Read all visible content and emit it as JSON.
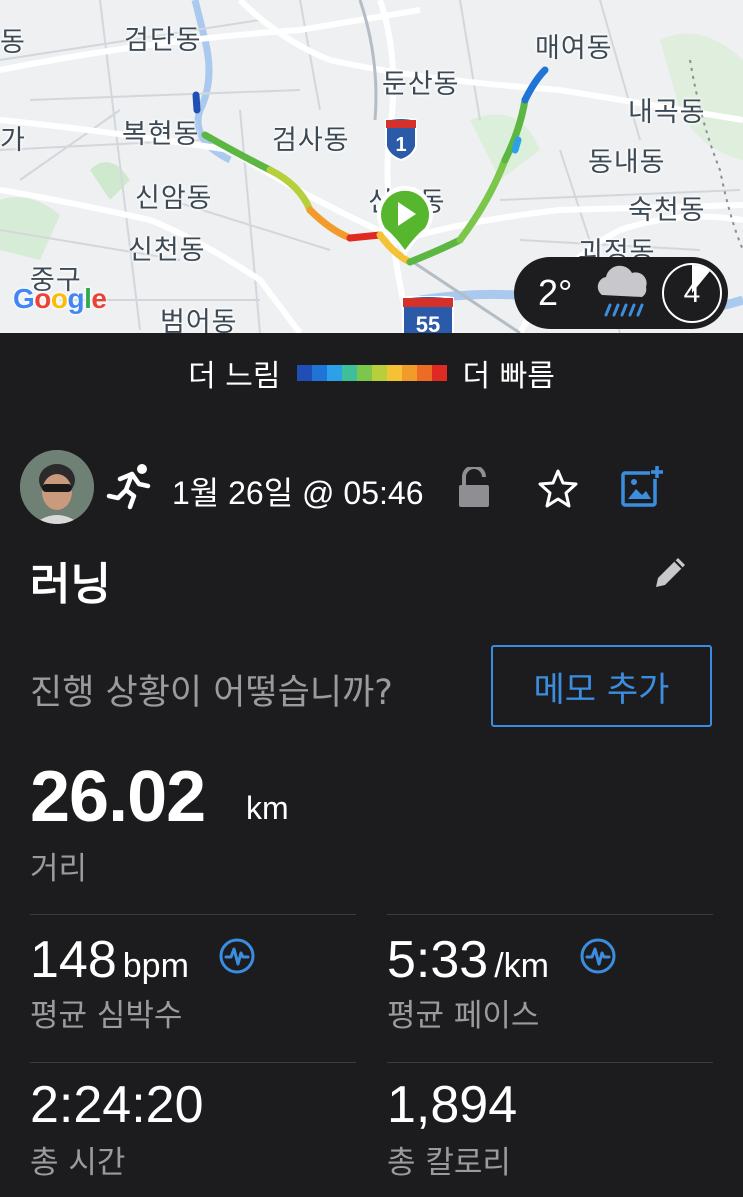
{
  "map": {
    "labels": {
      "geomdan": "검단동",
      "maeyeo": "매여동",
      "dunsan": "둔산동",
      "naegok": "내곡동",
      "bokhyeon": "복현동",
      "geomsa": "검사동",
      "dongnae": "동내동",
      "sinam": "신암동",
      "seocheon": "신천동",
      "sincheon": "신천동",
      "sukcheon": "숙천동",
      "gwijeong": "괴정동",
      "junggu": "중구",
      "beomeo": "범어동",
      "left_a": "동",
      "left_b": "가"
    },
    "shield_1": "1",
    "shield_55": "55",
    "google": [
      "G",
      "o",
      "o",
      "g",
      "l",
      "e"
    ],
    "weather": {
      "temp": "2°",
      "icon": "rain-cloud-icon",
      "lap": "4"
    }
  },
  "legend": {
    "slower": "더 느림",
    "faster": "더 빠름",
    "colors": [
      "#1f4fb5",
      "#1f74d6",
      "#2ea0e8",
      "#3fbe9a",
      "#7cc64b",
      "#b7cf3a",
      "#f4c234",
      "#f29a2a",
      "#ec6b25",
      "#df2a22"
    ]
  },
  "activity": {
    "date": "1월 26일 @ 05:46",
    "title": "러닝",
    "prompt": "진행 상황이 어떻습니까?",
    "memo_button": "메모 추가"
  },
  "distance": {
    "value": "26.02",
    "unit": "km",
    "label": "거리"
  },
  "stats": {
    "heart_rate": {
      "value": "148",
      "unit": "bpm",
      "label": "평균 심박수"
    },
    "pace": {
      "value": "5:33",
      "unit": "/km",
      "label": "평균 페이스"
    },
    "time": {
      "value": "2:24:20",
      "label": "총 시간"
    },
    "calories": {
      "value": "1,894",
      "label": "총 칼로리"
    }
  },
  "colors": {
    "accent": "#3b8de0",
    "background": "#1c1c1e",
    "muted_text": "#9b9b9f"
  }
}
